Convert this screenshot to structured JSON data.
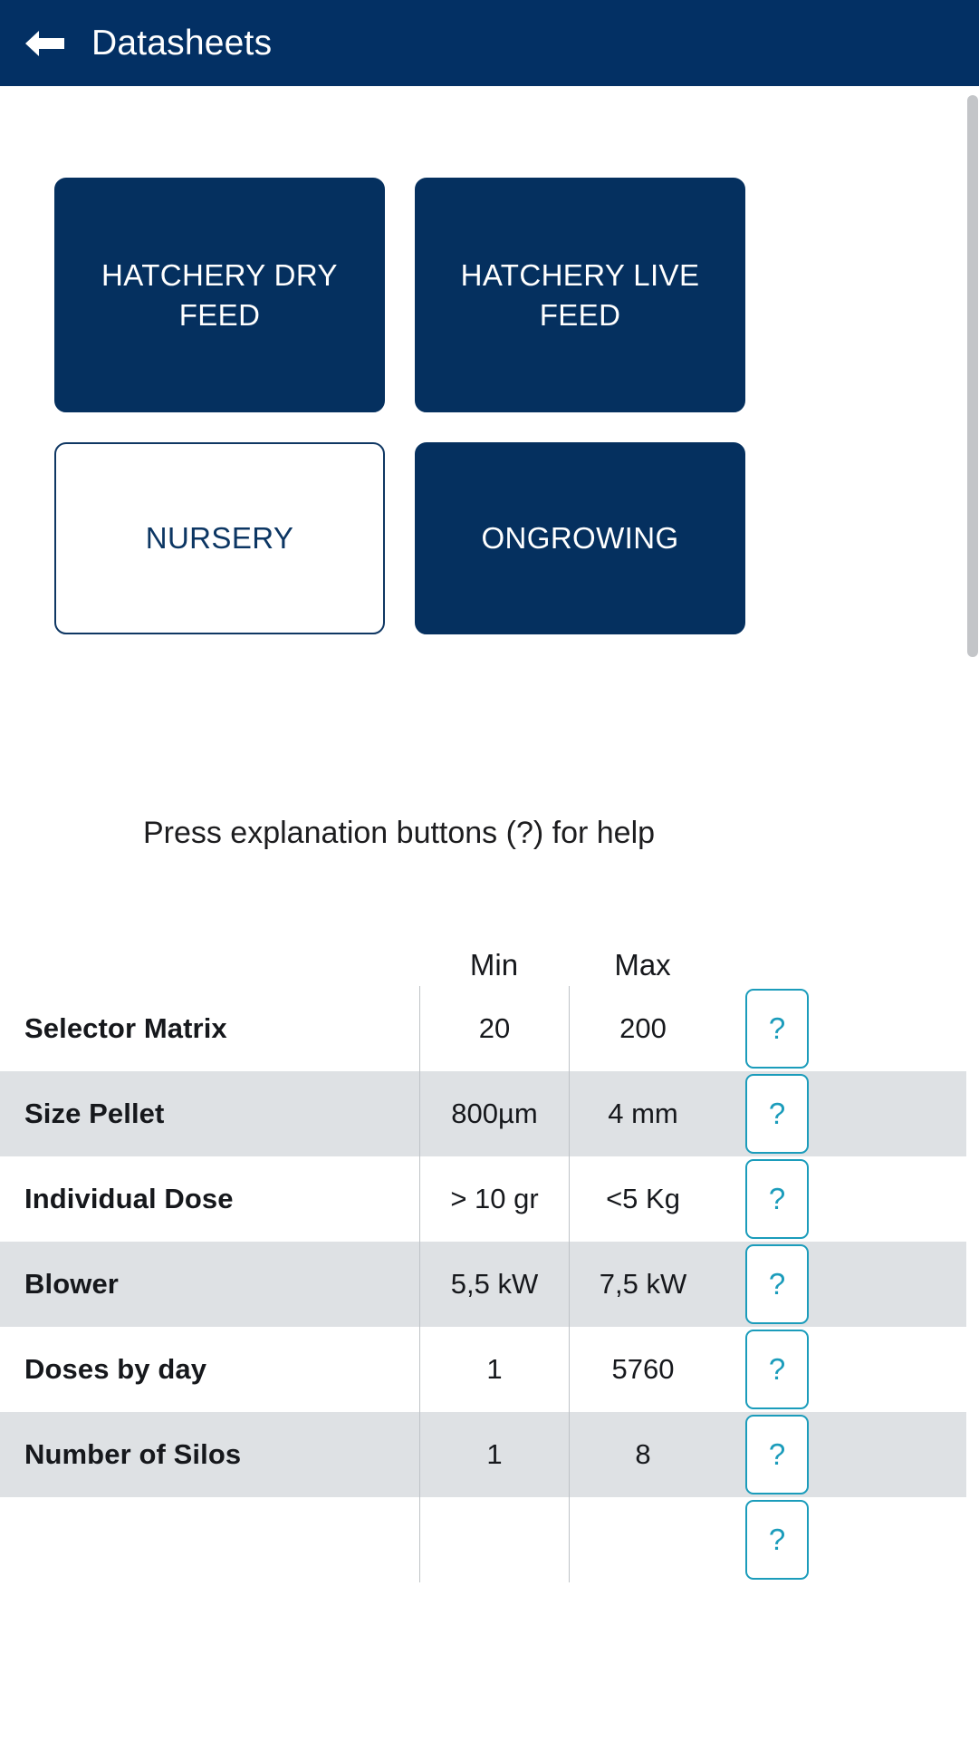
{
  "header": {
    "back_icon": "arrow-left-icon",
    "title": "Datasheets",
    "background": "#033064",
    "text_color": "#ffffff"
  },
  "categories": [
    {
      "label": "HATCHERY DRY FEED",
      "selected": true,
      "size": "tall"
    },
    {
      "label": "HATCHERY LIVE FEED",
      "selected": true,
      "size": "tall"
    },
    {
      "label": "NURSERY",
      "selected": false,
      "size": "short"
    },
    {
      "label": "ONGROWING",
      "selected": true,
      "size": "short"
    }
  ],
  "hint": {
    "text": "Press explanation buttons (?) for help"
  },
  "table": {
    "headers": {
      "label": "",
      "min": "Min",
      "max": "Max",
      "help": ""
    },
    "help_label": "?",
    "rows": [
      {
        "label": "Selector Matrix",
        "min": "20",
        "max": "200",
        "help": "?"
      },
      {
        "label": "Size Pellet",
        "min": "800µm",
        "max": "4 mm",
        "help": "?"
      },
      {
        "label": "Individual Dose",
        "min": "> 10 gr",
        "max": "<5 Kg",
        "help": "?"
      },
      {
        "label": "Blower",
        "min": "5,5 kW",
        "max": "7,5 kW",
        "help": "?"
      },
      {
        "label": "Doses by day",
        "min": "1",
        "max": "5760",
        "help": "?"
      },
      {
        "label": "Number of Silos",
        "min": "1",
        "max": "8",
        "help": "?"
      },
      {
        "label": "",
        "min": "",
        "max": "",
        "help": "?"
      }
    ]
  },
  "colors": {
    "primary_navy": "#05305f",
    "appbar_navy": "#033064",
    "accent_teal": "#1b9cbb",
    "row_alt": "#dee1e4",
    "divider": "#bfc3c7",
    "scrollbar": "#c3c5c8"
  }
}
